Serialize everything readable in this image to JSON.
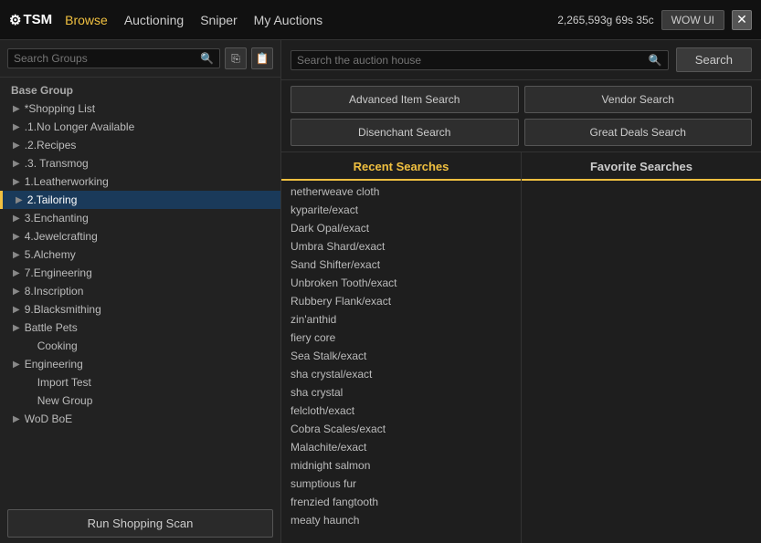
{
  "titleBar": {
    "logo": "⚙TSM",
    "navLinks": [
      {
        "label": "Browse",
        "active": true
      },
      {
        "label": "Auctioning",
        "active": false
      },
      {
        "label": "Sniper",
        "active": false
      },
      {
        "label": "My Auctions",
        "active": false
      }
    ],
    "goldDisplay": "2,265,593g 69s 35c",
    "wowUILabel": "WOW UI",
    "closeLabel": "✕"
  },
  "leftPanel": {
    "searchPlaceholder": "Search Groups",
    "baseGroupLabel": "Base Group",
    "groups": [
      {
        "label": "*Shopping List",
        "indent": 0,
        "hasArrow": true,
        "active": false
      },
      {
        "label": ".1.No Longer Available",
        "indent": 0,
        "hasArrow": true,
        "active": false
      },
      {
        "label": ".2.Recipes",
        "indent": 0,
        "hasArrow": true,
        "active": false
      },
      {
        "label": ".3. Transmog",
        "indent": 0,
        "hasArrow": true,
        "active": false
      },
      {
        "label": "1.Leatherworking",
        "indent": 0,
        "hasArrow": true,
        "active": false
      },
      {
        "label": "2.Tailoring",
        "indent": 0,
        "hasArrow": true,
        "active": true
      },
      {
        "label": "3.Enchanting",
        "indent": 0,
        "hasArrow": true,
        "active": false
      },
      {
        "label": "4.Jewelcrafting",
        "indent": 0,
        "hasArrow": true,
        "active": false
      },
      {
        "label": "5.Alchemy",
        "indent": 0,
        "hasArrow": true,
        "active": false
      },
      {
        "label": "7.Engineering",
        "indent": 0,
        "hasArrow": true,
        "active": false
      },
      {
        "label": "8.Inscription",
        "indent": 0,
        "hasArrow": true,
        "active": false
      },
      {
        "label": "9.Blacksmithing",
        "indent": 0,
        "hasArrow": true,
        "active": false
      },
      {
        "label": "Battle Pets",
        "indent": 0,
        "hasArrow": true,
        "active": false
      },
      {
        "label": "Cooking",
        "indent": 1,
        "hasArrow": false,
        "active": false
      },
      {
        "label": "Engineering",
        "indent": 0,
        "hasArrow": true,
        "active": false
      },
      {
        "label": "Import Test",
        "indent": 1,
        "hasArrow": false,
        "active": false
      },
      {
        "label": "New Group",
        "indent": 1,
        "hasArrow": false,
        "active": false
      },
      {
        "label": "WoD BoE",
        "indent": 0,
        "hasArrow": true,
        "active": false
      }
    ],
    "runScanLabel": "Run Shopping Scan"
  },
  "rightPanel": {
    "searchPlaceholder": "Search the auction house",
    "searchButtonLabel": "Search",
    "actionButtons": [
      {
        "label": "Advanced Item Search"
      },
      {
        "label": "Vendor Search"
      },
      {
        "label": "Disenchant Search"
      },
      {
        "label": "Great Deals Search"
      }
    ],
    "recentHeader": "Recent Searches",
    "favoriteHeader": "Favorite Searches",
    "recentSearches": [
      "netherweave cloth",
      "kyparite/exact",
      "Dark Opal/exact",
      "Umbra Shard/exact",
      "Sand Shifter/exact",
      "Unbroken Tooth/exact",
      "Rubbery Flank/exact",
      "zin'anthid",
      "fiery core",
      "Sea Stalk/exact",
      "sha crystal/exact",
      "sha crystal",
      "felcloth/exact",
      "Cobra Scales/exact",
      "Malachite/exact",
      "midnight salmon",
      "sumptious fur",
      "frenzied fangtooth",
      "meaty haunch"
    ],
    "favoriteSearches": []
  }
}
